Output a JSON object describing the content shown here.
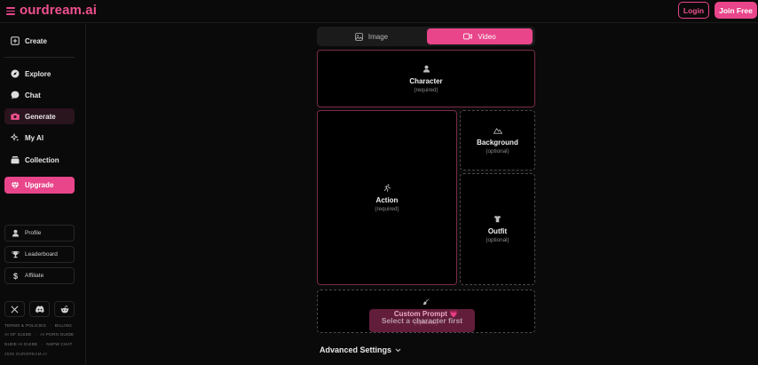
{
  "header": {
    "logo": "ourdream.ai",
    "login_label": "Login",
    "join_label": "Join Free"
  },
  "sidebar": {
    "create": "Create",
    "items": [
      {
        "label": "Explore",
        "icon": "compass-icon"
      },
      {
        "label": "Chat",
        "icon": "chat-bubble-icon"
      },
      {
        "label": "Generate",
        "icon": "camera-icon",
        "active": true
      },
      {
        "label": "My AI",
        "icon": "sparkle-icon"
      },
      {
        "label": "Collection",
        "icon": "folder-icon"
      }
    ],
    "upgrade_label": "Upgrade",
    "small_items": [
      {
        "label": "Profile",
        "icon": "user-icon"
      },
      {
        "label": "Leaderboard",
        "icon": "trophy-icon"
      },
      {
        "label": "Affiliate",
        "icon": "dollar-icon"
      }
    ],
    "social": [
      "x-icon",
      "discord-icon",
      "reddit-icon"
    ],
    "footer_links_row1": [
      "TERMS & POLICIES",
      "BILLING"
    ],
    "footer_links_row2": [
      "AI GF GUIDE",
      "AI PORN GUIDE"
    ],
    "footer_links_row3": [
      "NUDE AI GUIDE",
      "NSFW CHAT"
    ],
    "copyright": "2025 OURDREAM.AI"
  },
  "tabs": {
    "image_label": "Image",
    "video_label": "Video",
    "active": "Video"
  },
  "cards": {
    "character": {
      "title": "Character",
      "sub": "(required)"
    },
    "action": {
      "title": "Action",
      "sub": "(required)"
    },
    "background": {
      "title": "Background",
      "sub": "(optional)"
    },
    "outfit": {
      "title": "Outfit",
      "sub": "(optional)"
    },
    "custom_prompt": {
      "title": "Custom Prompt",
      "sub": "(optional)"
    }
  },
  "overlay_text": "Select a character first",
  "advanced_settings": "Advanced Settings",
  "colors": {
    "accent": "#e8458a",
    "background": "#0a0a0a"
  }
}
